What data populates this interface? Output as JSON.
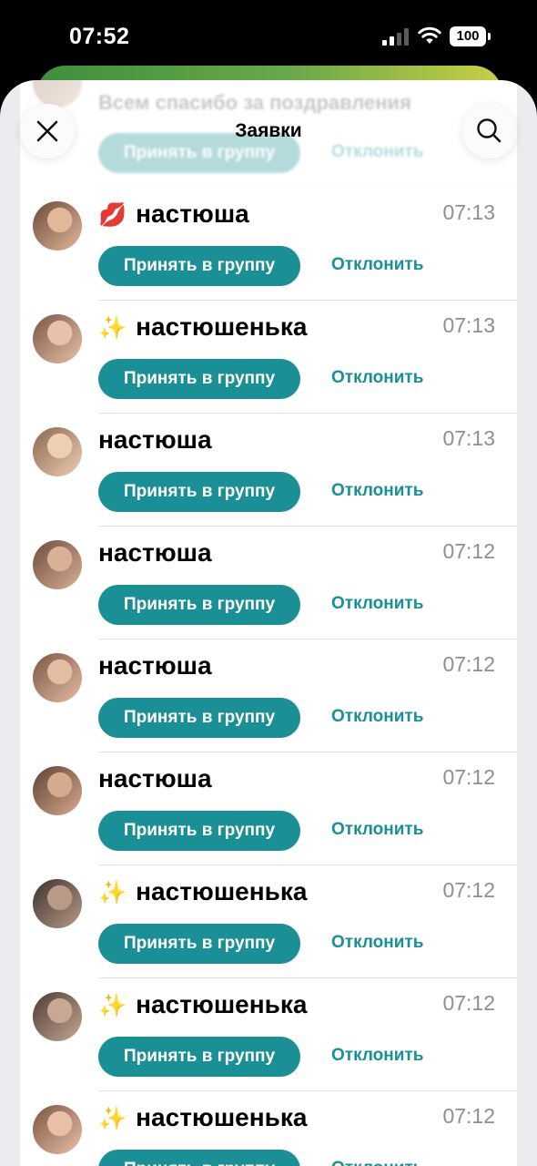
{
  "status_bar": {
    "time": "07:52",
    "battery": "100"
  },
  "header": {
    "title": "Заявки"
  },
  "partial_row": {
    "message": "Всем спасибо за поздравления",
    "accept_label": "Принять в группу",
    "reject_label": "Отклонить"
  },
  "requests": [
    {
      "emoji": "💋",
      "name": "настюша",
      "time": "07:13",
      "accept_label": "Принять в группу",
      "reject_label": "Отклонить"
    },
    {
      "emoji": "✨",
      "name": "настюшенька",
      "time": "07:13",
      "accept_label": "Принять в группу",
      "reject_label": "Отклонить"
    },
    {
      "emoji": "",
      "name": "настюша",
      "time": "07:13",
      "accept_label": "Принять в группу",
      "reject_label": "Отклонить"
    },
    {
      "emoji": "",
      "name": "настюша",
      "time": "07:12",
      "accept_label": "Принять в группу",
      "reject_label": "Отклонить"
    },
    {
      "emoji": "",
      "name": "настюша",
      "time": "07:12",
      "accept_label": "Принять в группу",
      "reject_label": "Отклонить"
    },
    {
      "emoji": "",
      "name": "настюша",
      "time": "07:12",
      "accept_label": "Принять в группу",
      "reject_label": "Отклонить"
    },
    {
      "emoji": "✨",
      "name": "настюшенька",
      "time": "07:12",
      "accept_label": "Принять в группу",
      "reject_label": "Отклонить"
    },
    {
      "emoji": "✨",
      "name": "настюшенька",
      "time": "07:12",
      "accept_label": "Принять в группу",
      "reject_label": "Отклонить"
    },
    {
      "emoji": "✨",
      "name": "настюшенька",
      "time": "07:12",
      "accept_label": "Принять в группу",
      "reject_label": "Отклонить"
    }
  ],
  "colors": {
    "accent": "#1a8f95",
    "time_text": "#8e8e93",
    "sheet_background": "#ececf0"
  }
}
